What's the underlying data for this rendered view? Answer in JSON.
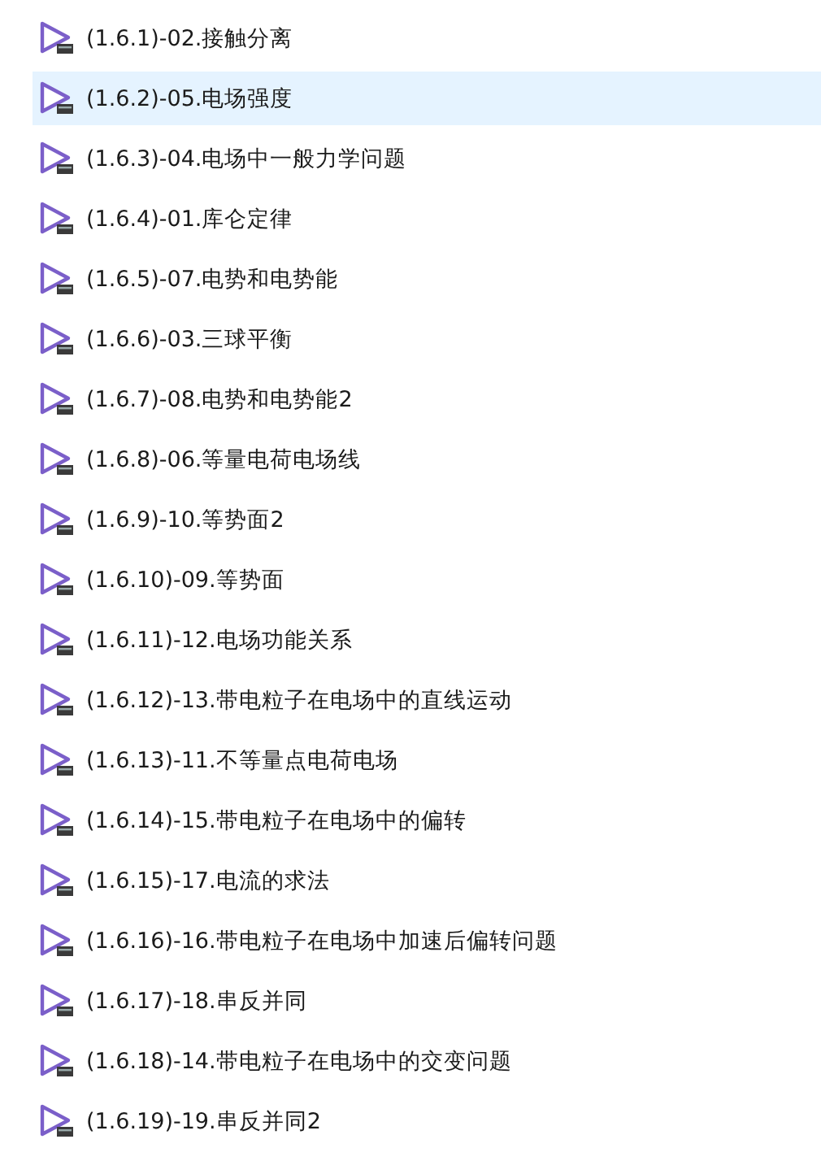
{
  "files": [
    {
      "name": "(1.6.1)-02.接触分离",
      "selected": false
    },
    {
      "name": "(1.6.2)-05.电场强度",
      "selected": true
    },
    {
      "name": "(1.6.3)-04.电场中一般力学问题",
      "selected": false
    },
    {
      "name": "(1.6.4)-01.库仑定律",
      "selected": false
    },
    {
      "name": "(1.6.5)-07.电势和电势能",
      "selected": false
    },
    {
      "name": "(1.6.6)-03.三球平衡",
      "selected": false
    },
    {
      "name": "(1.6.7)-08.电势和电势能2",
      "selected": false
    },
    {
      "name": "(1.6.8)-06.等量电荷电场线",
      "selected": false
    },
    {
      "name": "(1.6.9)-10.等势面2",
      "selected": false
    },
    {
      "name": "(1.6.10)-09.等势面",
      "selected": false
    },
    {
      "name": "(1.6.11)-12.电场功能关系",
      "selected": false
    },
    {
      "name": "(1.6.12)-13.带电粒子在电场中的直线运动",
      "selected": false
    },
    {
      "name": "(1.6.13)-11.不等量点电荷电场",
      "selected": false
    },
    {
      "name": "(1.6.14)-15.带电粒子在电场中的偏转",
      "selected": false
    },
    {
      "name": "(1.6.15)-17.电流的求法",
      "selected": false
    },
    {
      "name": "(1.6.16)-16.带电粒子在电场中加速后偏转问题",
      "selected": false
    },
    {
      "name": "(1.6.17)-18.串反并同",
      "selected": false
    },
    {
      "name": "(1.6.18)-14.带电粒子在电场中的交变问题",
      "selected": false
    },
    {
      "name": "(1.6.19)-19.串反并同2",
      "selected": false
    }
  ]
}
